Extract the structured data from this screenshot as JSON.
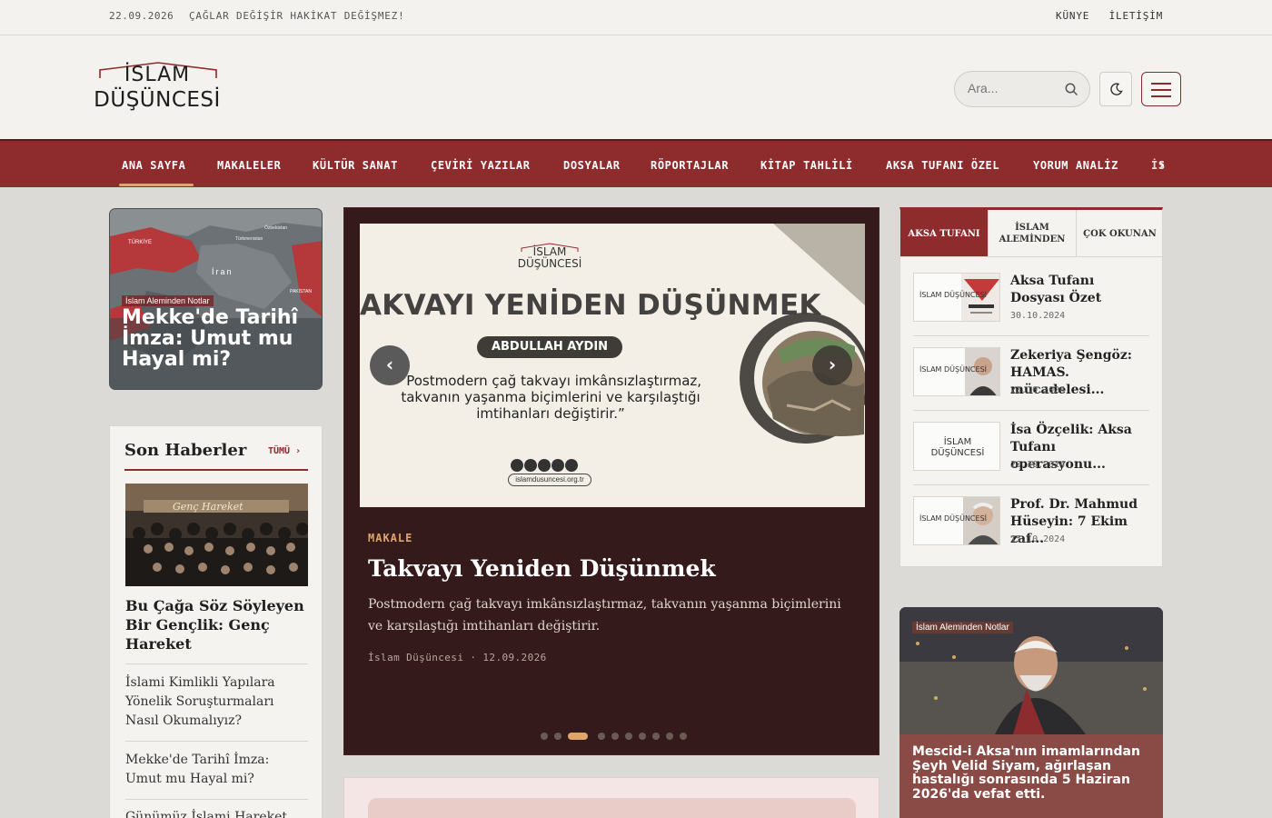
{
  "topbar": {
    "date": "22.09.2026",
    "motto": "ÇAĞLAR DEĞİŞİR HAKİKAT DEĞİŞMEZ!",
    "links": [
      "KÜNYE",
      "İLETİŞİM"
    ]
  },
  "brand": {
    "line1": "İSLAM",
    "line2": "DÜŞÜNCESİ",
    "accent_color": "#8e2b2d"
  },
  "search": {
    "placeholder": "Ara..."
  },
  "nav": {
    "items": [
      "ANA SAYFA",
      "MAKALELER",
      "KÜLTÜR SANAT",
      "ÇEVİRİ YAZILAR",
      "DOSYALAR",
      "RÖPORTAJLAR",
      "KİTAP TAHLİLİ",
      "AKSA TUFANI ÖZEL",
      "YORUM ANALİZ",
      "İS"
    ],
    "active": "ANA SAYFA"
  },
  "left_feature": {
    "badge": "İslam Aleminden Notlar",
    "title": "Mekke'de Tarihî İmza: Umut mu Hayal mi?",
    "map_labels": [
      "TÜRKİYE",
      "İran",
      "Özbekistan",
      "Türkmenistan",
      "PAKİSTAN"
    ]
  },
  "news": {
    "heading": "Son Haberler",
    "all_label": "TÜMÜ ›",
    "photo_text": "Genç Hareket",
    "lead": "Bu Çağa Söz Söyleyen Bir Gençlik: Genç Hareket",
    "items": [
      "İslami Kimlikli Yapılara Yönelik Soruşturmaları Nasıl Okumalıyız?",
      "Mekke'de Tarihî İmza: Umut mu Hayal mi?",
      "Günümüz İslami Hareket"
    ]
  },
  "hero": {
    "slide": {
      "logo_line1": "İSLAM",
      "logo_line2": "DÜŞÜNCESİ",
      "big_title": "AKVAYI YENİDEN DÜŞÜNMEK",
      "author": "ABDULLAH AYDIN",
      "quote": "“Postmodern çağ takvayı imkânsızlaştırmaz, takvanın yaşanma biçimlerini ve karşılaştığı imtihanları değiştirir.”",
      "url": "islamdusuncesi.org.tr"
    },
    "prev": "‹",
    "next": "›",
    "category": "MAKALE",
    "title": "Takvayı Yeniden Düşünmek",
    "description": "Postmodern çağ takvayı imkânsızlaştırmaz, takvanın yaşanma biçimlerini ve karşılaştığı imtihanları değiştirir.",
    "meta": "İslam Düşüncesi · 12.09.2026",
    "dots_count": 10,
    "active_dot": 2
  },
  "tabs": {
    "labels": [
      "AKSA TUFANI",
      "İSLAM ALEMİNDEN",
      "ÇOK OKUNAN"
    ],
    "active": 0,
    "items": [
      {
        "title": "Aksa Tufanı Dosyası Özet",
        "date": "30.10.2024",
        "thumb": "İSLAM DÜŞÜNCESİ"
      },
      {
        "title": "Zekeriya Şengöz: HAMAS. mücadelesi...",
        "date": "23.10.2024",
        "thumb": "İSLAM DÜŞÜNCESİ"
      },
      {
        "title": "İsa Özçelik: Aksa Tufanı operasyonu...",
        "date": "20.10.2024",
        "thumb": "İSLAM DÜŞÜNCESİ"
      },
      {
        "title": "Prof. Dr. Mahmud Hüseyin: 7 Ekim zaf...",
        "date": "15.10.2024",
        "thumb": "İSLAM DÜŞÜNCESİ"
      }
    ]
  },
  "right_feature": {
    "tag": "İslam Aleminden Notlar",
    "title": "Mescid-i Aksa'nın imamlarından Şeyh Velid Siyam, ağırlaşan hastalığı sonrasında 5 Haziran 2026'da vefat etti."
  }
}
